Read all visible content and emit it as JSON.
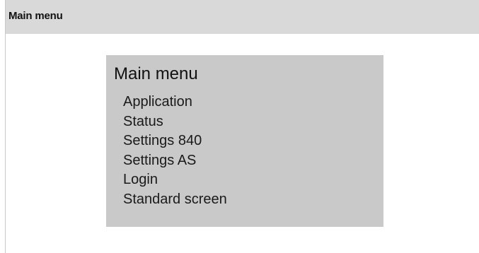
{
  "window": {
    "title": "Main menu"
  },
  "menu": {
    "heading": "Main menu",
    "items": [
      {
        "label": "Application"
      },
      {
        "label": "Status"
      },
      {
        "label": "Settings 840"
      },
      {
        "label": "Settings AS"
      },
      {
        "label": "Login"
      },
      {
        "label": "Standard screen"
      }
    ]
  },
  "colors": {
    "titlebar_bg": "#d9d9d9",
    "panel_bg": "#c9c9c9",
    "page_bg": "#ffffff",
    "text": "#111111"
  }
}
